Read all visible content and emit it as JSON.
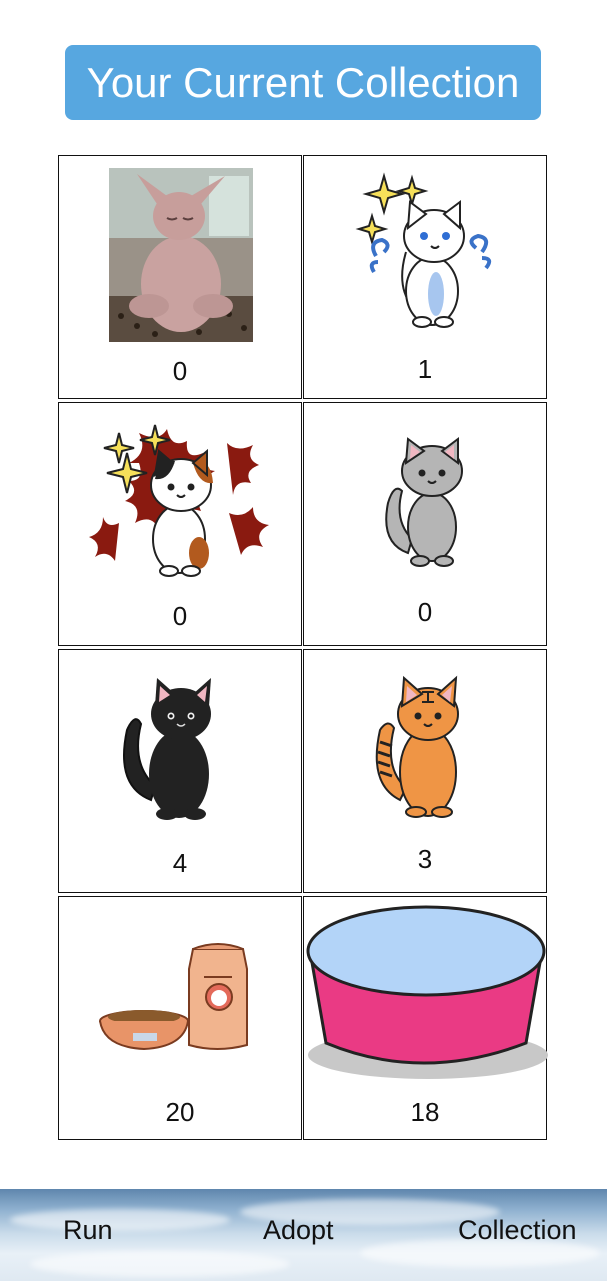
{
  "header": {
    "title": "Your Current Collection"
  },
  "collection": [
    {
      "item": "hairless-cat-photo",
      "count": "0"
    },
    {
      "item": "sparkle-white-cat",
      "count": "1"
    },
    {
      "item": "sparkle-calico-cat",
      "count": "0"
    },
    {
      "item": "gray-cat",
      "count": "0"
    },
    {
      "item": "black-cat",
      "count": "4"
    },
    {
      "item": "orange-tabby-cat",
      "count": "3"
    },
    {
      "item": "cat-food-bowl-and-bag",
      "count": "20"
    },
    {
      "item": "pink-water-bowl",
      "count": "18"
    }
  ],
  "tabbar": {
    "run": "Run",
    "adopt": "Adopt",
    "collection": "Collection"
  }
}
